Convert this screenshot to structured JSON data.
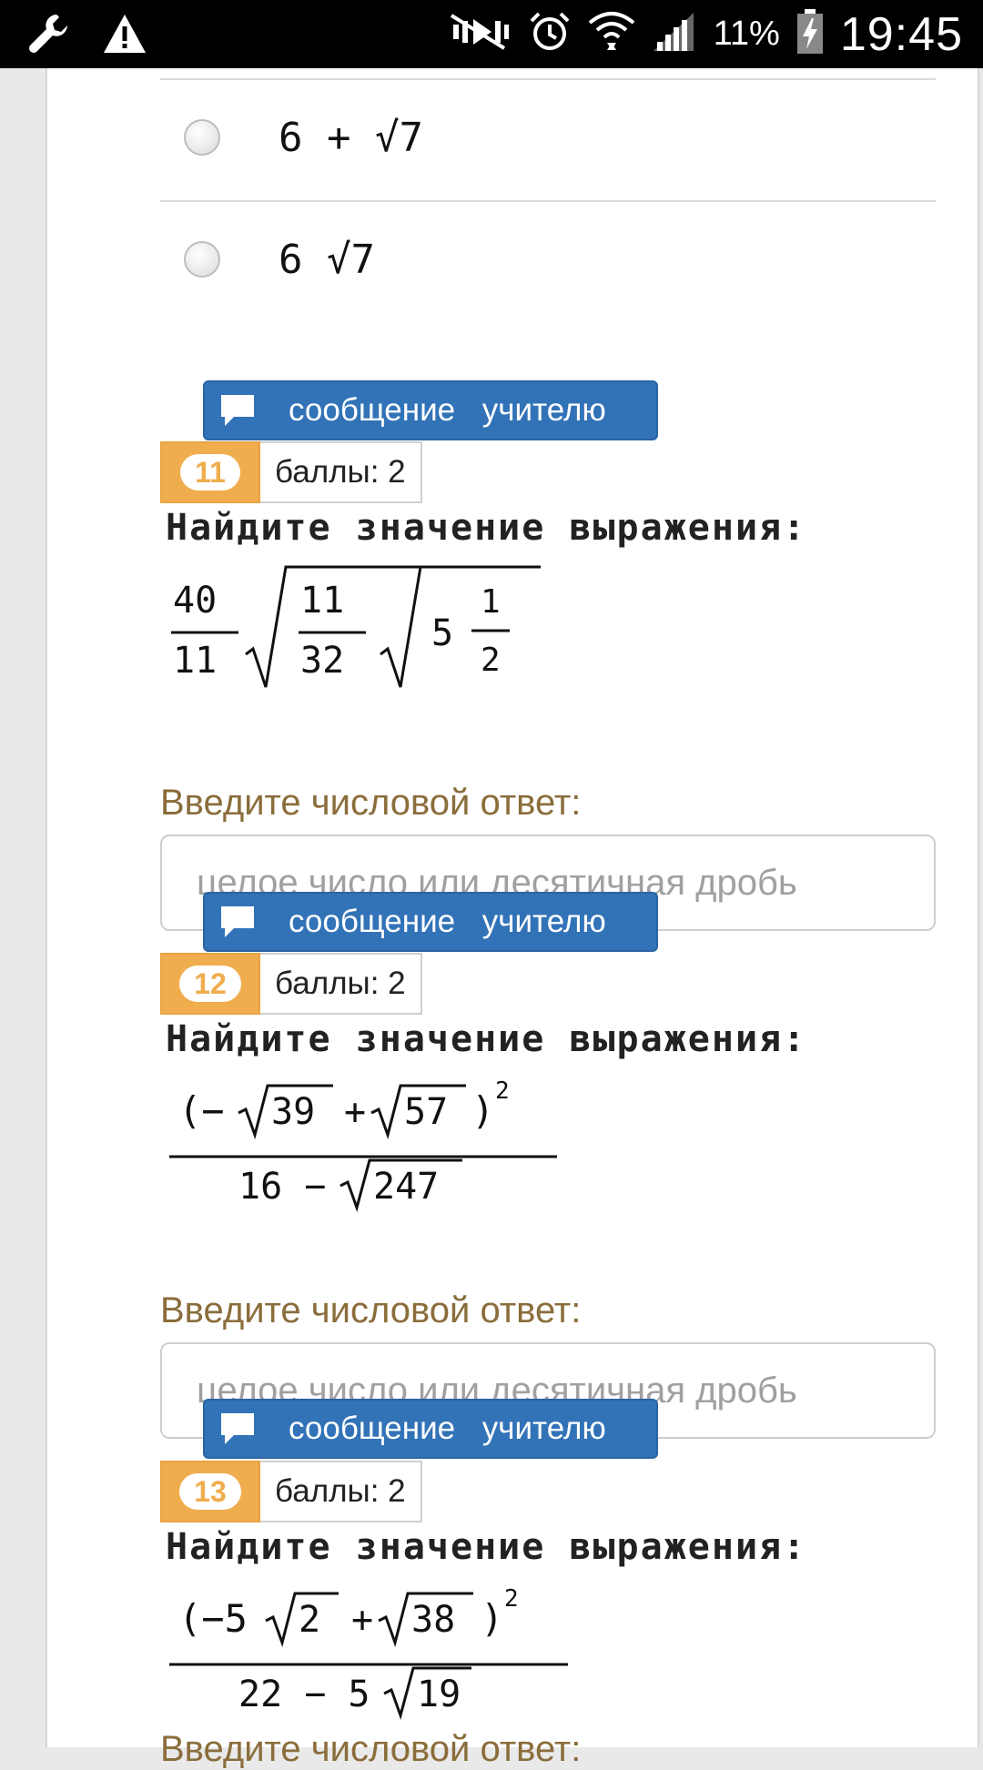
{
  "status_bar": {
    "icons_left": [
      "wrench-icon",
      "warning-icon"
    ],
    "icons_right": [
      "mute-icon",
      "alarm-icon",
      "wifi-icon",
      "signal-icon",
      "battery-icon"
    ],
    "battery_percent": "11%",
    "time": "19:45"
  },
  "options": [
    {
      "text": "6 + √7"
    },
    {
      "text": "6 √7"
    }
  ],
  "message_button_label": "сообщение учителю",
  "questions": [
    {
      "number": "11",
      "points": "баллы: 2",
      "prompt": "Найдите значение выражения:",
      "formula": {
        "a": "40",
        "b": "11",
        "c": "11",
        "d": "32",
        "whole": "5",
        "e": "1",
        "f": "2"
      },
      "answer_label": "Введите числовой ответ:",
      "answer_placeholder": "целое число или десятичная дробь",
      "answer_value": ""
    },
    {
      "number": "12",
      "points": "баллы: 2",
      "prompt": "Найдите значение выражения:",
      "formula": {
        "num_left": "(−",
        "r1": "39",
        "plus": "+",
        "r2": "57",
        "num_right": ")",
        "pow": "2",
        "den_a": "16 −",
        "den_r": "247"
      },
      "answer_label": "Введите числовой ответ:",
      "answer_placeholder": "целое число или десятичная дробь",
      "answer_value": ""
    },
    {
      "number": "13",
      "points": "баллы: 2",
      "prompt": "Найдите значение выражения:",
      "formula": {
        "num_left": "(−5",
        "r1": "2",
        "plus": "+",
        "r2": "38",
        "num_right": ")",
        "pow": "2",
        "den_a": "22 − 5",
        "den_r": "19"
      },
      "answer_label": "Введите числовой ответ:"
    }
  ]
}
